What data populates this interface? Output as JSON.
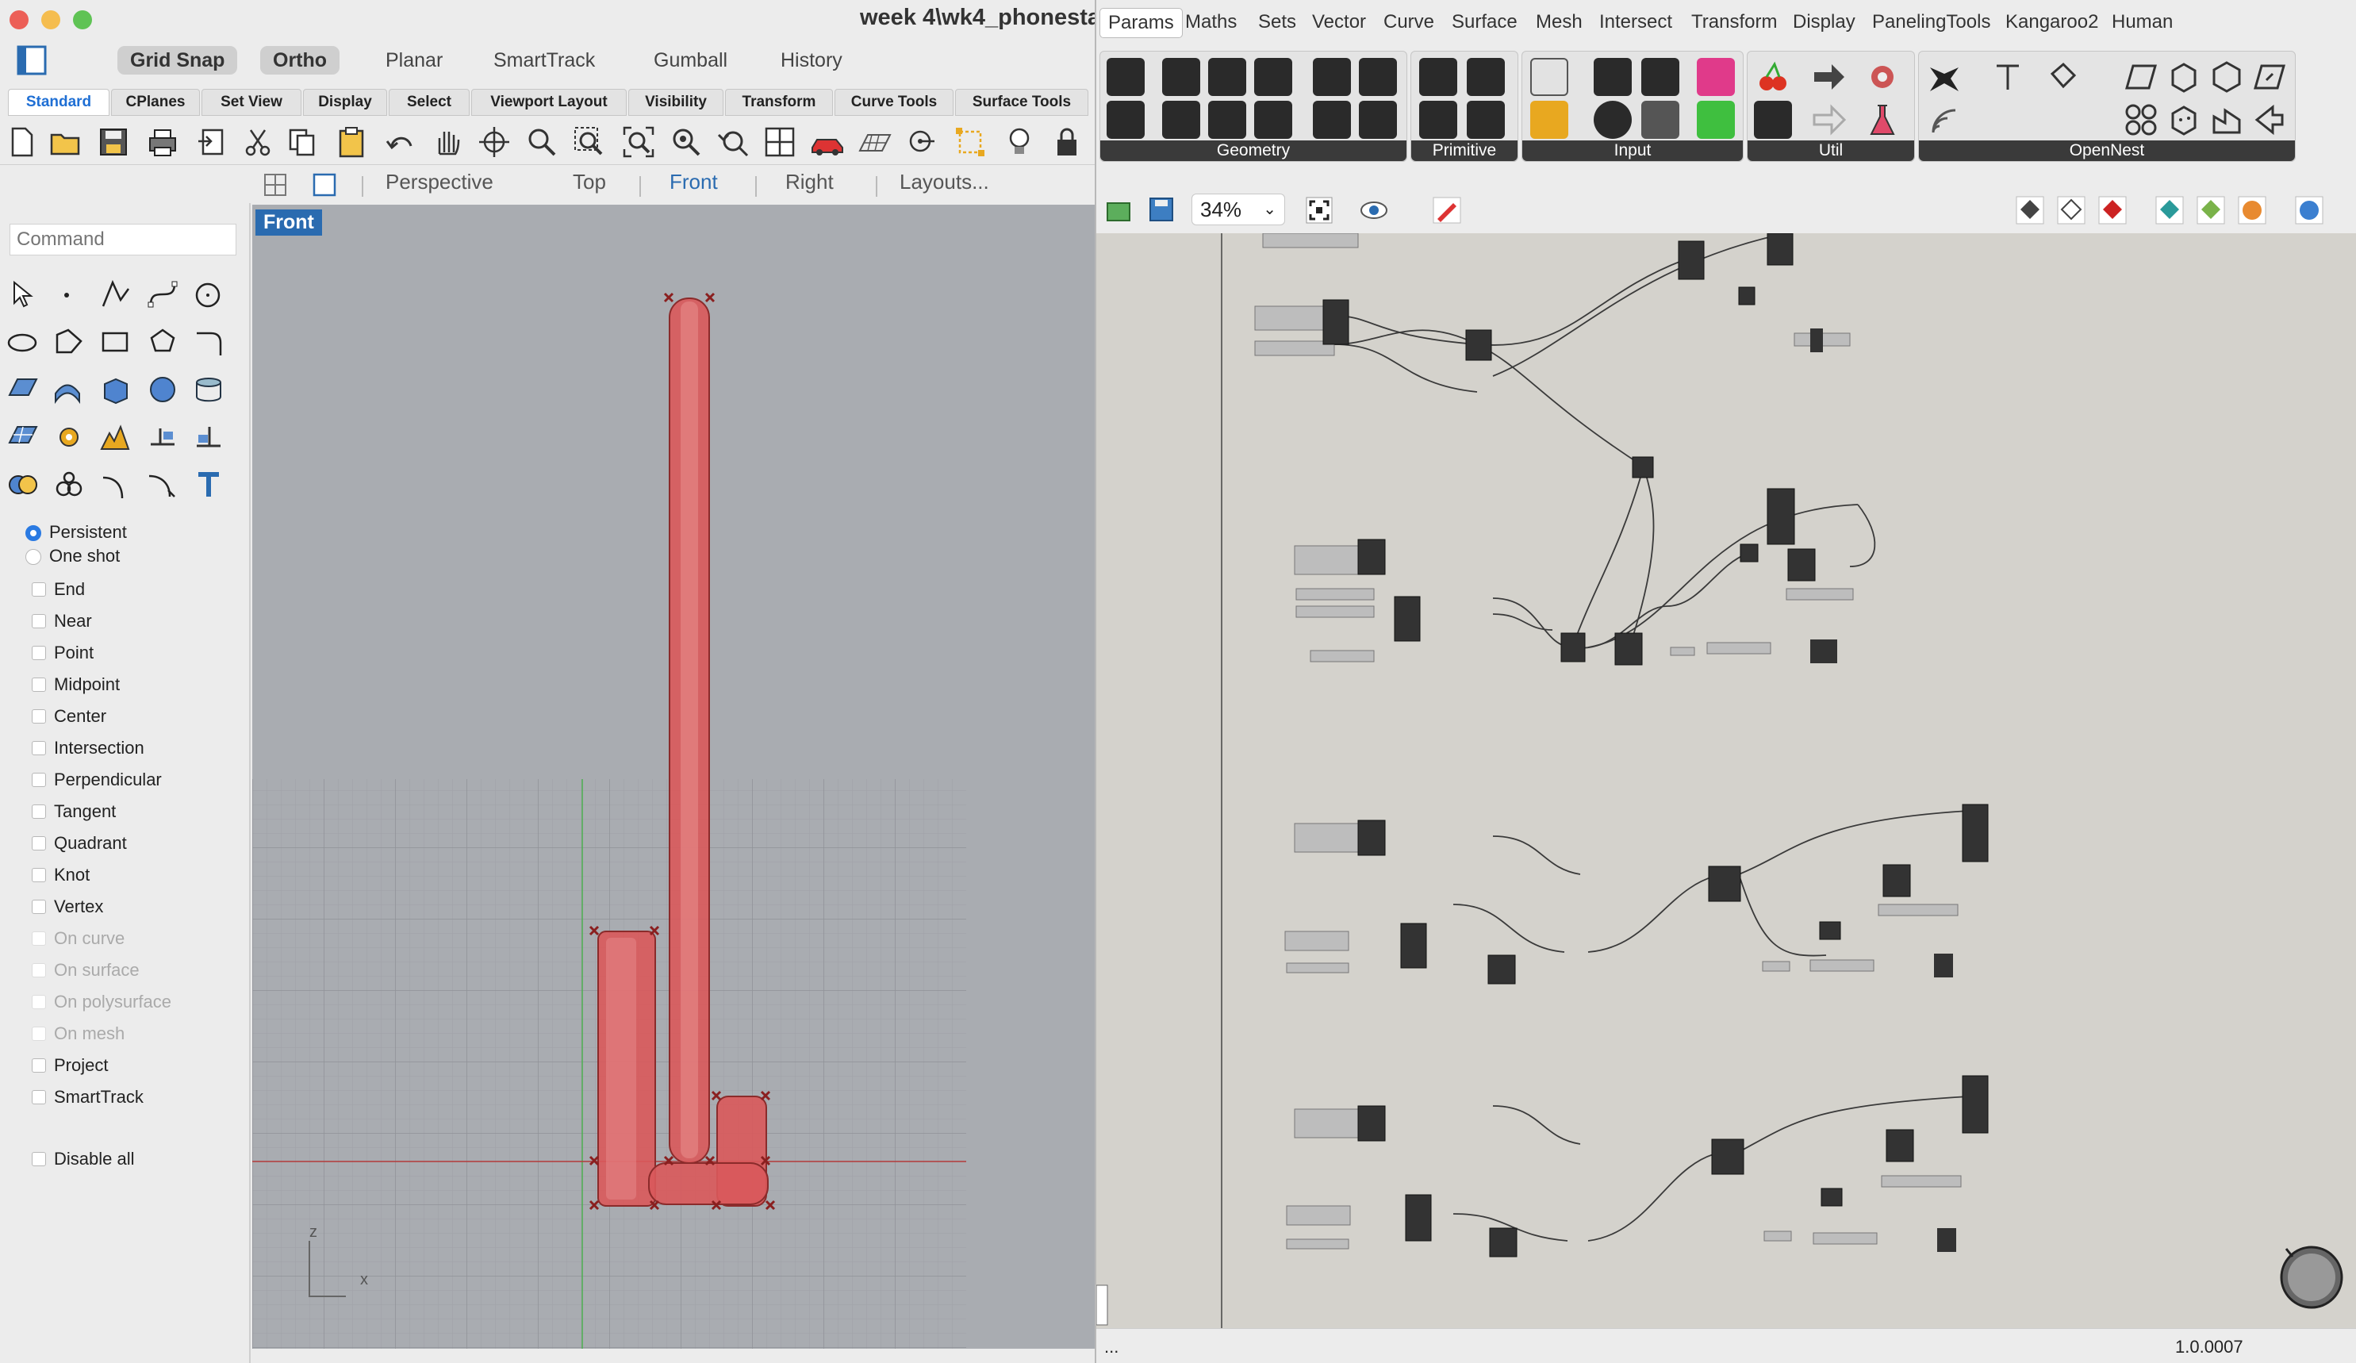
{
  "rhino": {
    "title": "week 4\\wk4_phonesta",
    "modes": [
      "Grid Snap",
      "Ortho",
      "Planar",
      "SmartTrack",
      "Gumball",
      "History"
    ],
    "tabs": [
      "Standard",
      "CPlanes",
      "Set View",
      "Display",
      "Select",
      "Viewport Layout",
      "Visibility",
      "Transform",
      "Curve Tools",
      "Surface Tools"
    ],
    "active_tab": "Standard",
    "view_tabs": [
      "Perspective",
      "Top",
      "Front",
      "Right",
      "Layouts..."
    ],
    "active_view": "Front",
    "command_placeholder": "Command",
    "viewport_label": "Front",
    "snap_modes": [
      "Persistent",
      "One shot"
    ],
    "osnaps": [
      "End",
      "Near",
      "Point",
      "Midpoint",
      "Center",
      "Intersection",
      "Perpendicular",
      "Tangent",
      "Quadrant",
      "Knot",
      "Vertex"
    ],
    "osnaps_disabled": [
      "On curve",
      "On surface",
      "On polysurface",
      "On mesh"
    ],
    "extra_snaps": [
      "Project",
      "SmartTrack"
    ],
    "disable_all": "Disable all",
    "axis_z": "z",
    "axis_x": "x",
    "model_color": "#d9595b"
  },
  "gh": {
    "tabs": [
      "Params",
      "Maths",
      "Sets",
      "Vector",
      "Curve",
      "Surface",
      "Mesh",
      "Intersect",
      "Transform",
      "Display",
      "PanelingTools",
      "Kangaroo2",
      "Human"
    ],
    "active_tab": "Params",
    "groups": [
      "Geometry",
      "Primitive",
      "Input",
      "Util",
      "OpenNest"
    ],
    "zoom": "34%",
    "status_left": "...",
    "version": "1.0.0007"
  }
}
